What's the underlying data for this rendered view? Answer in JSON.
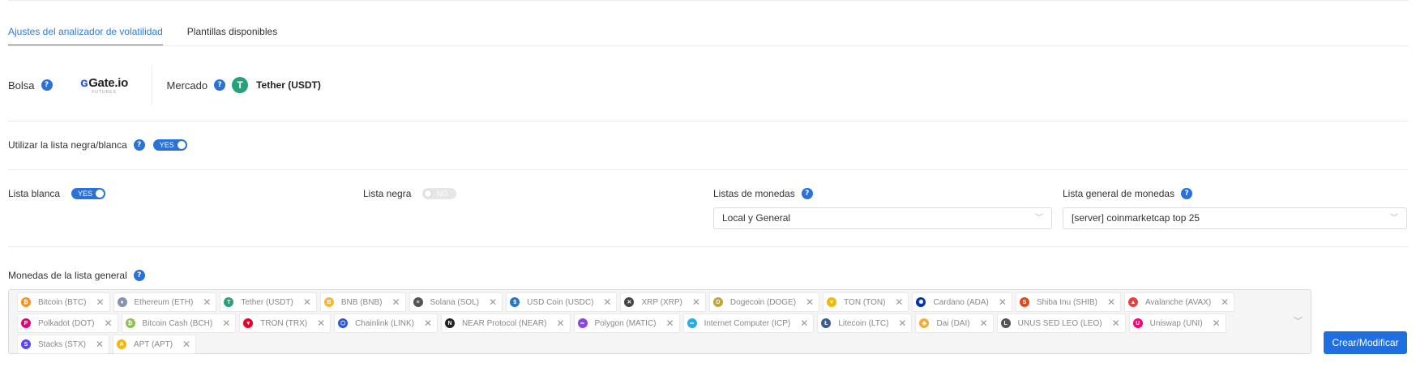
{
  "tabs": [
    {
      "label": "Ajustes del analizador de volatilidad",
      "active": true
    },
    {
      "label": "Plantillas disponibles",
      "active": false
    }
  ],
  "exchange": {
    "label": "Bolsa",
    "help": "?",
    "logo_text": "Gate.io",
    "logo_sub": "FUTURES"
  },
  "market": {
    "label": "Mercado",
    "help": "?",
    "icon_letter": "T",
    "name": "Tether (USDT)"
  },
  "blacklist_whitelist": {
    "label": "Utilizar la lista negra/blanca",
    "help": "?",
    "toggle": "YES"
  },
  "whitelist": {
    "label": "Lista blanca",
    "toggle": "YES"
  },
  "blacklist": {
    "label": "Lista negra",
    "toggle": "NO"
  },
  "coin_lists": {
    "label": "Listas de monedas",
    "help": "?",
    "value": "Local y General"
  },
  "general_list": {
    "label": "Lista general de monedas",
    "help": "?",
    "value": "[server] coinmarketcap top 25"
  },
  "general_coins": {
    "label": "Monedas de la lista general",
    "help": "?",
    "coins": [
      {
        "name": "Bitcoin (BTC)",
        "color": "#f7931a",
        "glyph": "₿"
      },
      {
        "name": "Ethereum (ETH)",
        "color": "#8a92b2",
        "glyph": "♦"
      },
      {
        "name": "Tether (USDT)",
        "color": "#26a17b",
        "glyph": "T"
      },
      {
        "name": "BNB (BNB)",
        "color": "#f3ba2f",
        "glyph": "B"
      },
      {
        "name": "Solana (SOL)",
        "color": "#555555",
        "glyph": "≡"
      },
      {
        "name": "USD Coin (USDC)",
        "color": "#2775ca",
        "glyph": "$"
      },
      {
        "name": "XRP (XRP)",
        "color": "#444444",
        "glyph": "✕"
      },
      {
        "name": "Dogecoin (DOGE)",
        "color": "#c2a633",
        "glyph": "D"
      },
      {
        "name": "TON (TON)",
        "color": "#f0b90b",
        "glyph": "▼"
      },
      {
        "name": "Cardano (ADA)",
        "color": "#0033ad",
        "glyph": "✺"
      },
      {
        "name": "Shiba Inu (SHIB)",
        "color": "#e0491a",
        "glyph": "S"
      },
      {
        "name": "Avalanche (AVAX)",
        "color": "#e84142",
        "glyph": "▲"
      },
      {
        "name": "Polkadot (DOT)",
        "color": "#e6007a",
        "glyph": "P"
      },
      {
        "name": "Bitcoin Cash (BCH)",
        "color": "#8dc351",
        "glyph": "₿"
      },
      {
        "name": "TRON (TRX)",
        "color": "#eb0029",
        "glyph": "▼"
      },
      {
        "name": "Chainlink (LINK)",
        "color": "#2a5ada",
        "glyph": "⬡"
      },
      {
        "name": "NEAR Protocol (NEAR)",
        "color": "#222222",
        "glyph": "N"
      },
      {
        "name": "Polygon (MATIC)",
        "color": "#8247e5",
        "glyph": "∞"
      },
      {
        "name": "Internet Computer (ICP)",
        "color": "#29abe2",
        "glyph": "∞"
      },
      {
        "name": "Litecoin (LTC)",
        "color": "#345d9d",
        "glyph": "Ł"
      },
      {
        "name": "Dai (DAI)",
        "color": "#f5ac37",
        "glyph": "◈"
      },
      {
        "name": "UNUS SED LEO (LEO)",
        "color": "#555555",
        "glyph": "L"
      },
      {
        "name": "Uniswap (UNI)",
        "color": "#ff007a",
        "glyph": "U"
      },
      {
        "name": "Stacks (STX)",
        "color": "#5546ff",
        "glyph": "S"
      },
      {
        "name": "APT (APT)",
        "color": "#f0b90b",
        "glyph": "A"
      }
    ]
  },
  "submit_button": "Crear/Modificar",
  "colors": {
    "accent": "#2b72d8",
    "button": "#1f6fe0"
  }
}
